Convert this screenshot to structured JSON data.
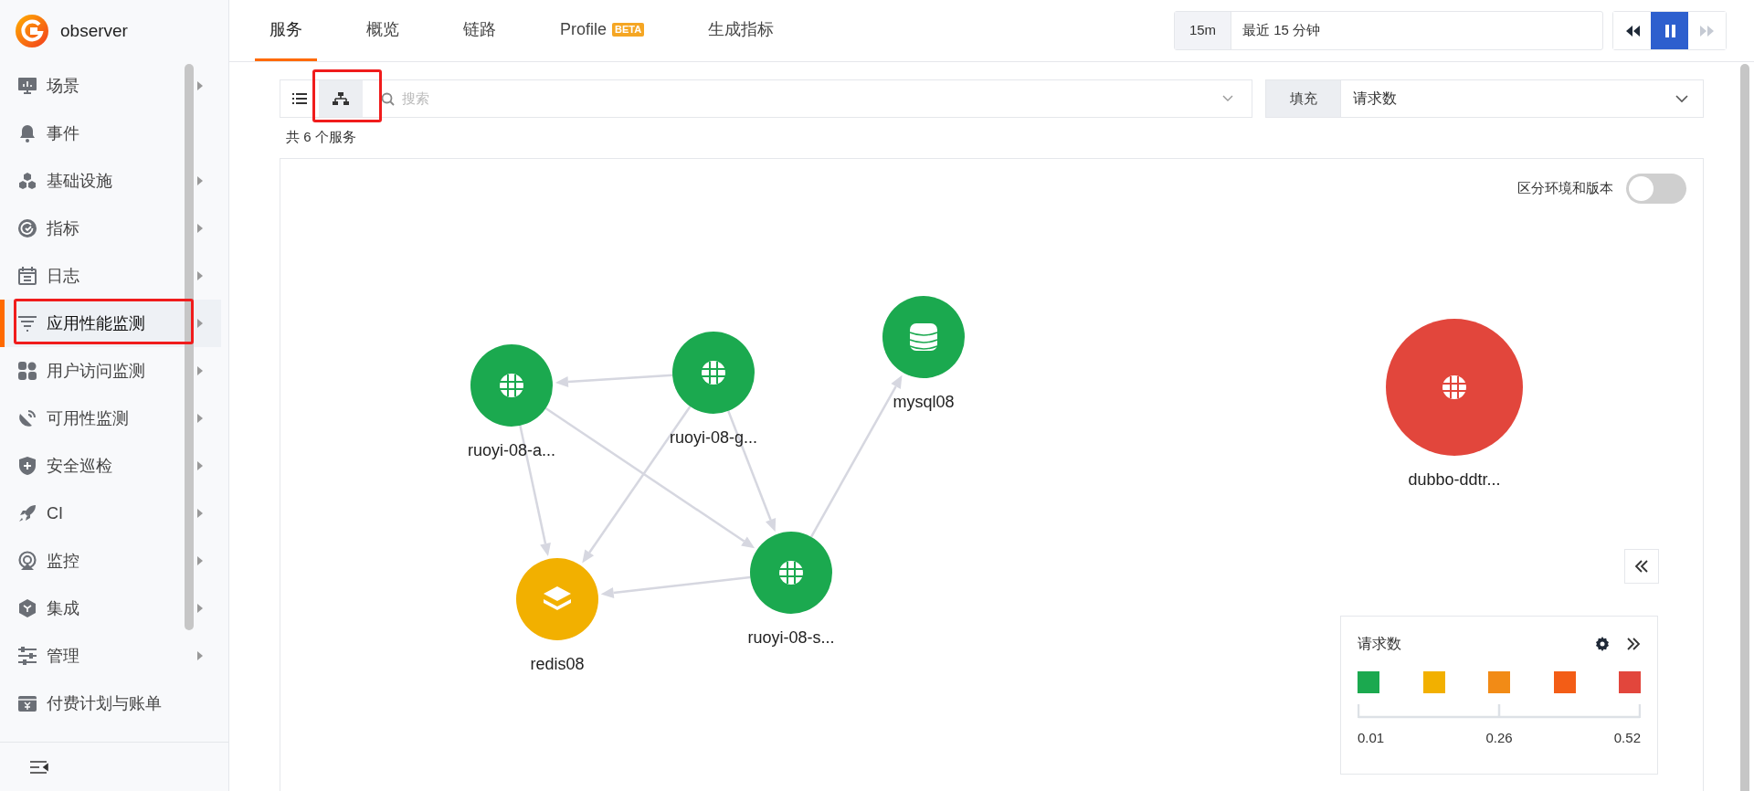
{
  "brand": {
    "name": "observer"
  },
  "sidebar": {
    "items": [
      {
        "label": "场景",
        "has_submenu": true,
        "selected": false
      },
      {
        "label": "事件",
        "has_submenu": false,
        "selected": false
      },
      {
        "label": "基础设施",
        "has_submenu": true,
        "selected": false
      },
      {
        "label": "指标",
        "has_submenu": true,
        "selected": false
      },
      {
        "label": "日志",
        "has_submenu": true,
        "selected": false
      },
      {
        "label": "应用性能监测",
        "has_submenu": true,
        "selected": true
      },
      {
        "label": "用户访问监测",
        "has_submenu": true,
        "selected": false
      },
      {
        "label": "可用性监测",
        "has_submenu": true,
        "selected": false
      },
      {
        "label": "安全巡检",
        "has_submenu": true,
        "selected": false
      },
      {
        "label": "CI",
        "has_submenu": true,
        "selected": false
      },
      {
        "label": "监控",
        "has_submenu": true,
        "selected": false
      },
      {
        "label": "集成",
        "has_submenu": true,
        "selected": false
      },
      {
        "label": "管理",
        "has_submenu": true,
        "selected": false
      },
      {
        "label": "付费计划与账单",
        "has_submenu": false,
        "selected": false
      }
    ]
  },
  "tabs": [
    {
      "label": "服务",
      "selected": true
    },
    {
      "label": "概览",
      "selected": false
    },
    {
      "label": "链路",
      "selected": false
    },
    {
      "label": "Profile",
      "badge": "BETA",
      "selected": false
    },
    {
      "label": "生成指标",
      "selected": false
    }
  ],
  "time_range": {
    "short": "15m",
    "value": "最近 15 分钟"
  },
  "playback": [
    {
      "kind": "rewind",
      "active": false,
      "disabled": false
    },
    {
      "kind": "pause",
      "active": true,
      "disabled": false
    },
    {
      "kind": "forward",
      "active": false,
      "disabled": true
    }
  ],
  "view_toggle": [
    {
      "kind": "list",
      "selected": false
    },
    {
      "kind": "map",
      "selected": true
    }
  ],
  "search": {
    "placeholder": "搜索"
  },
  "fill": {
    "label": "填充",
    "value": "请求数"
  },
  "count": "共 6 个服务",
  "env_toggle": {
    "label": "区分环境和版本",
    "on": false
  },
  "nodes": [
    {
      "label": "ruoyi-08-a...",
      "kind": "web",
      "color": "#1ba94f"
    },
    {
      "label": "ruoyi-08-g...",
      "kind": "web",
      "color": "#1ba94f"
    },
    {
      "label": "mysql08",
      "kind": "database",
      "color": "#1ba94f"
    },
    {
      "label": "ruoyi-08-s...",
      "kind": "web",
      "color": "#1ba94f"
    },
    {
      "label": "redis08",
      "kind": "cache",
      "color": "#f2b000"
    },
    {
      "label": "dubbo-ddtr...",
      "kind": "web",
      "color": "#e2463c"
    }
  ],
  "legend": {
    "title": "请求数",
    "colors": [
      {
        "color": "#1ba94f"
      },
      {
        "color": "#f2b000"
      },
      {
        "color": "#f28b16"
      },
      {
        "color": "#f35d16"
      },
      {
        "color": "#e2463c"
      }
    ],
    "ticks": [
      "0.01",
      "0.26",
      "0.52"
    ]
  }
}
